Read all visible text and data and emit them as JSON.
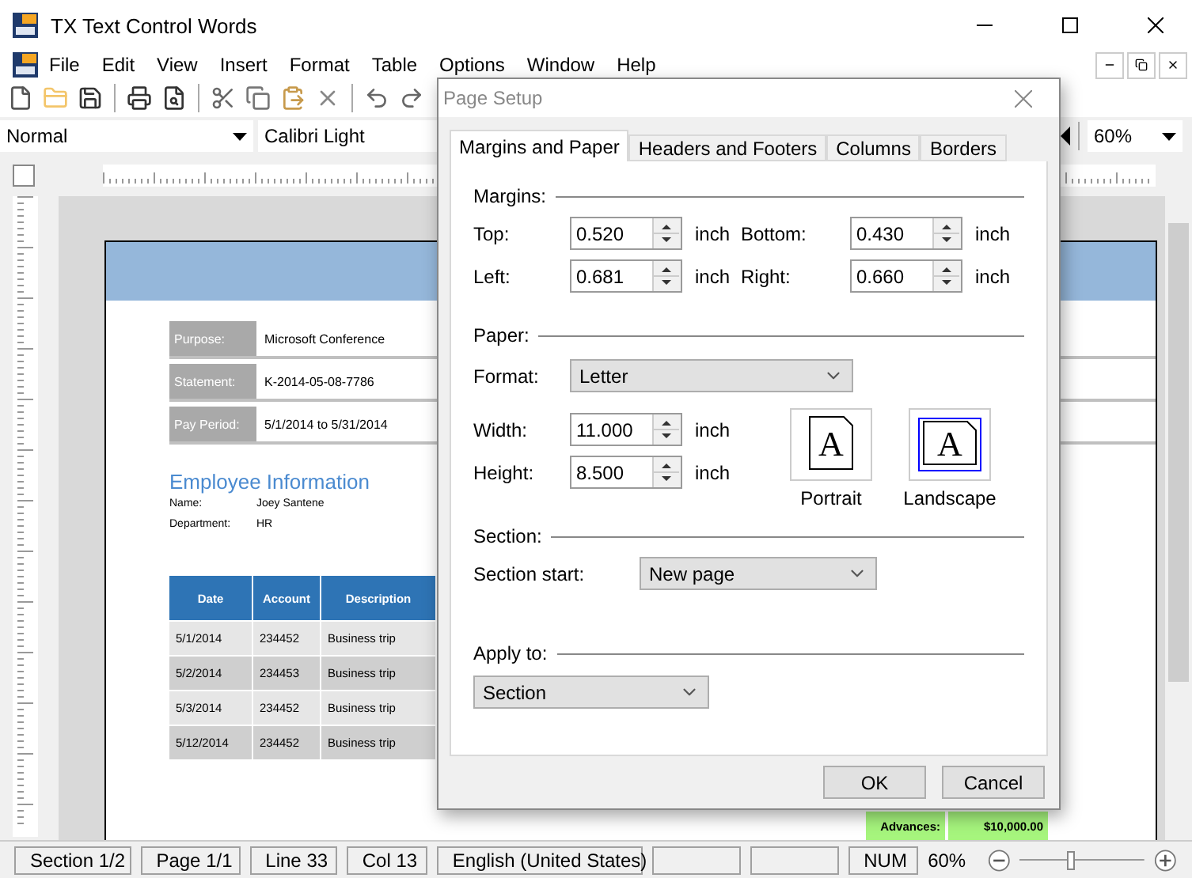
{
  "window": {
    "title": "TX Text Control Words"
  },
  "menu": [
    "File",
    "Edit",
    "View",
    "Insert",
    "Format",
    "Table",
    "Options",
    "Window",
    "Help"
  ],
  "style_combo": {
    "value": "Normal"
  },
  "font_combo": {
    "value": "Calibri Light"
  },
  "zoom_combo": {
    "value": "60%"
  },
  "document": {
    "info_rows": [
      {
        "label": "Purpose:",
        "value": "Microsoft Conference"
      },
      {
        "label": "Statement:",
        "value": "K-2014-05-08-7786"
      },
      {
        "label": "Pay Period:",
        "value": "5/1/2014 to 5/31/2014"
      }
    ],
    "heading": "Employee Information",
    "employee": [
      {
        "label": "Name:",
        "value": "Joey Santene"
      },
      {
        "label": "Department:",
        "value": "HR"
      }
    ],
    "table": {
      "columns": [
        "Date",
        "Account",
        "Description"
      ],
      "rows": [
        [
          "5/1/2014",
          "234452",
          "Business trip"
        ],
        [
          "5/2/2014",
          "234453",
          "Business trip"
        ],
        [
          "5/3/2014",
          "234452",
          "Business trip"
        ],
        [
          "5/12/2014",
          "234452",
          "Business trip"
        ]
      ]
    },
    "totals": {
      "label": "Advances:",
      "value": "$10,000.00"
    }
  },
  "dialog": {
    "title": "Page Setup",
    "tabs": [
      {
        "label": "Margins and Paper",
        "selected": true
      },
      {
        "label": "Headers and Footers",
        "selected": false
      },
      {
        "label": "Columns",
        "selected": false
      },
      {
        "label": "Borders",
        "selected": false
      }
    ],
    "margins": {
      "title": "Margins:",
      "fields": [
        {
          "label": "Top:",
          "value": "0.520",
          "unit": "inch"
        },
        {
          "label": "Bottom:",
          "value": "0.430",
          "unit": "inch"
        },
        {
          "label": "Left:",
          "value": "0.681",
          "unit": "inch"
        },
        {
          "label": "Right:",
          "value": "0.660",
          "unit": "inch"
        }
      ]
    },
    "paper": {
      "title": "Paper:",
      "format_label": "Format:",
      "format": "Letter",
      "fields": [
        {
          "label": "Width:",
          "value": "11.000",
          "unit": "inch"
        },
        {
          "label": "Height:",
          "value": "8.500",
          "unit": "inch"
        }
      ],
      "orientations": [
        {
          "label": "Portrait",
          "glyph": "A",
          "kind": "portrait",
          "selected": false
        },
        {
          "label": "Landscape",
          "glyph": "A",
          "kind": "landscape",
          "selected": true
        }
      ]
    },
    "section": {
      "title": "Section:",
      "start_label": "Section start:",
      "start": "New page"
    },
    "apply": {
      "title": "Apply to:",
      "value": "Section"
    },
    "buttons": [
      "OK",
      "Cancel"
    ]
  },
  "status_bar": {
    "panes": [
      {
        "kind": "text",
        "text": "Section 1/2"
      },
      {
        "kind": "text",
        "text": "Page 1/1"
      },
      {
        "kind": "text",
        "text": "Line 33"
      },
      {
        "kind": "text",
        "text": "Col 13"
      },
      {
        "kind": "text",
        "text": "English (United States)"
      },
      {
        "kind": "blank"
      },
      {
        "kind": "blank"
      },
      {
        "kind": "text",
        "text": "NUM"
      }
    ],
    "zoom": "60%",
    "zoom_slider": {
      "level": 0.4
    }
  }
}
